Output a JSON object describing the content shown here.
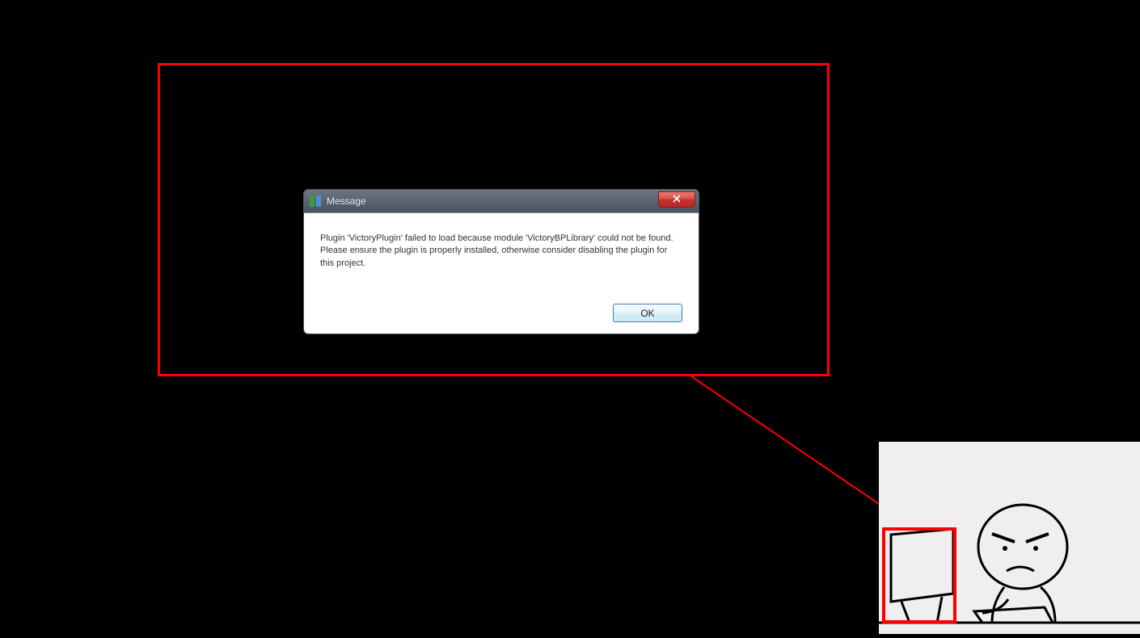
{
  "annotation": {
    "highlight_color": "#ff0000"
  },
  "dialog": {
    "title": "Message",
    "message": "Plugin 'VictoryPlugin' failed to load because module 'VictoryBPLibrary' could not be found.  Please ensure the plugin is properly installed, otherwise consider disabling the plugin for this project.",
    "ok_label": "OK"
  },
  "icons": {
    "app_icon": "app-icon",
    "close_icon": "close-icon"
  }
}
